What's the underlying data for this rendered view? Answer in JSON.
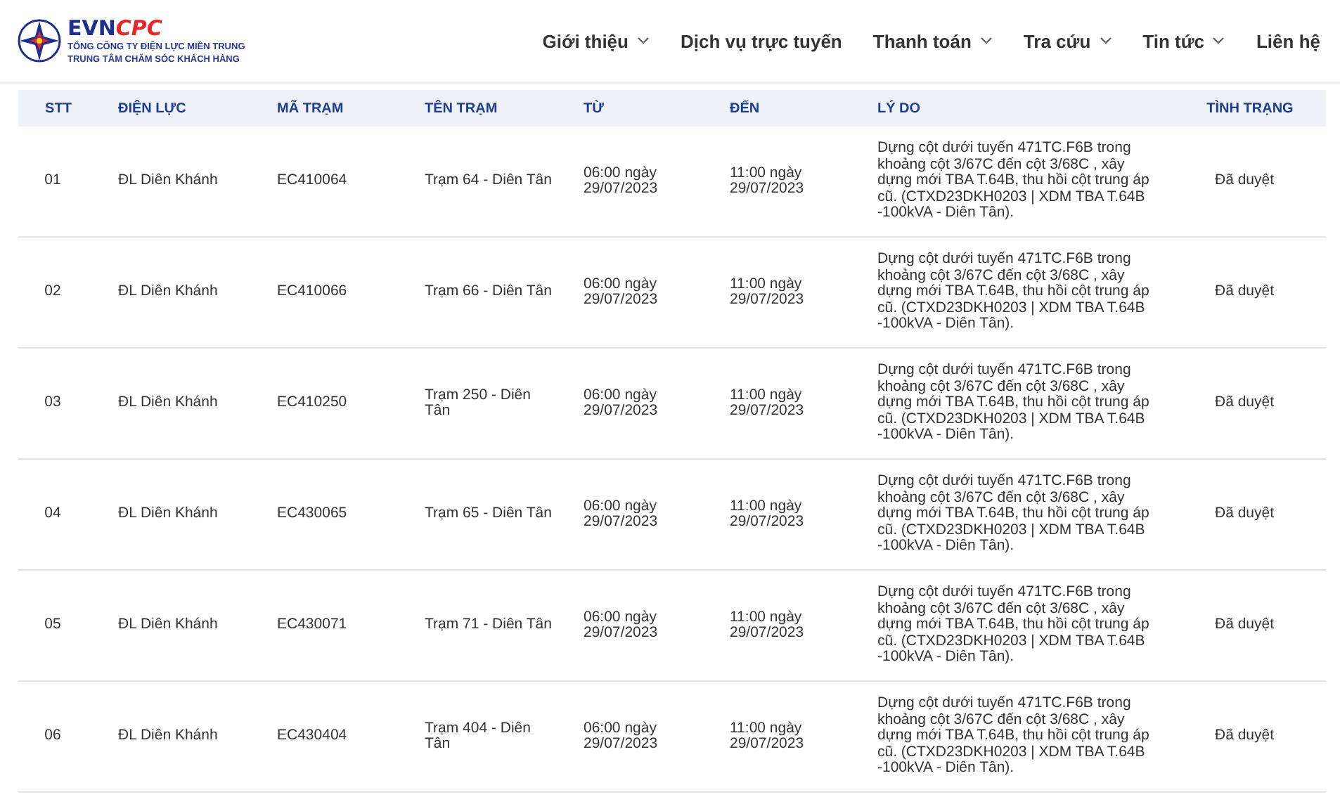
{
  "logo": {
    "brand_a": "EVN",
    "brand_b": "CPC",
    "line_1": "TỔNG CÔNG TY ĐIỆN LỰC MIỀN TRUNG",
    "line_2": "TRUNG TÂM CHĂM SÓC KHÁCH HÀNG"
  },
  "nav": [
    {
      "label": "Giới thiệu",
      "dropdown": true
    },
    {
      "label": "Dịch vụ trực tuyến",
      "dropdown": false
    },
    {
      "label": "Thanh toán",
      "dropdown": true
    },
    {
      "label": "Tra cứu",
      "dropdown": true
    },
    {
      "label": "Tin tức",
      "dropdown": true
    },
    {
      "label": "Liên hệ",
      "dropdown": false
    }
  ],
  "table": {
    "columns": [
      "STT",
      "ĐIỆN LỰC",
      "MÃ TRẠM",
      "TÊN TRẠM",
      "TỪ",
      "ĐẾN",
      "LÝ DO",
      "TÌNH TRẠNG"
    ],
    "rows": [
      [
        "01",
        "ĐL Diên Khánh",
        "EC410064",
        "Trạm 64 - Diên Tân",
        "06:00 ngày 29/07/2023",
        "11:00 ngày 29/07/2023",
        "Dựng cột dưới tuyến 471TC.F6B trong khoảng cột 3/67C đến cột 3/68C , xây dựng mới TBA T.64B, thu hồi cột trung áp cũ. (CTXD23DKH0203 | XDM TBA T.64B -100kVA - Diên Tân).",
        "Đã duyệt"
      ],
      [
        "02",
        "ĐL Diên Khánh",
        "EC410066",
        "Trạm 66 - Diên Tân",
        "06:00 ngày 29/07/2023",
        "11:00 ngày 29/07/2023",
        "Dựng cột dưới tuyến 471TC.F6B trong khoảng cột 3/67C đến cột 3/68C , xây dựng mới TBA T.64B, thu hồi cột trung áp cũ. (CTXD23DKH0203 | XDM TBA T.64B -100kVA - Diên Tân).",
        "Đã duyệt"
      ],
      [
        "03",
        "ĐL Diên Khánh",
        "EC410250",
        "Trạm 250 - Diên Tân",
        "06:00 ngày 29/07/2023",
        "11:00 ngày 29/07/2023",
        "Dựng cột dưới tuyến 471TC.F6B trong khoảng cột 3/67C đến cột 3/68C , xây dựng mới TBA T.64B, thu hồi cột trung áp cũ. (CTXD23DKH0203 | XDM TBA T.64B -100kVA - Diên Tân).",
        "Đã duyệt"
      ],
      [
        "04",
        "ĐL Diên Khánh",
        "EC430065",
        "Trạm 65 - Diên Tân",
        "06:00 ngày 29/07/2023",
        "11:00 ngày 29/07/2023",
        "Dựng cột dưới tuyến 471TC.F6B trong khoảng cột 3/67C đến cột 3/68C , xây dựng mới TBA T.64B, thu hồi cột trung áp cũ. (CTXD23DKH0203 | XDM TBA T.64B -100kVA - Diên Tân).",
        "Đã duyệt"
      ],
      [
        "05",
        "ĐL Diên Khánh",
        "EC430071",
        "Trạm 71 - Diên Tân",
        "06:00 ngày 29/07/2023",
        "11:00 ngày 29/07/2023",
        "Dựng cột dưới tuyến 471TC.F6B trong khoảng cột 3/67C đến cột 3/68C , xây dựng mới TBA T.64B, thu hồi cột trung áp cũ. (CTXD23DKH0203 | XDM TBA T.64B -100kVA - Diên Tân).",
        "Đã duyệt"
      ],
      [
        "06",
        "ĐL Diên Khánh",
        "EC430404",
        "Trạm 404 - Diên Tân",
        "06:00 ngày 29/07/2023",
        "11:00 ngày 29/07/2023",
        "Dựng cột dưới tuyến 471TC.F6B trong khoảng cột 3/67C đến cột 3/68C , xây dựng mới TBA T.64B, thu hồi cột trung áp cũ. (CTXD23DKH0203 | XDM TBA T.64B -100kVA - Diên Tân).",
        "Đã duyệt"
      ]
    ]
  }
}
